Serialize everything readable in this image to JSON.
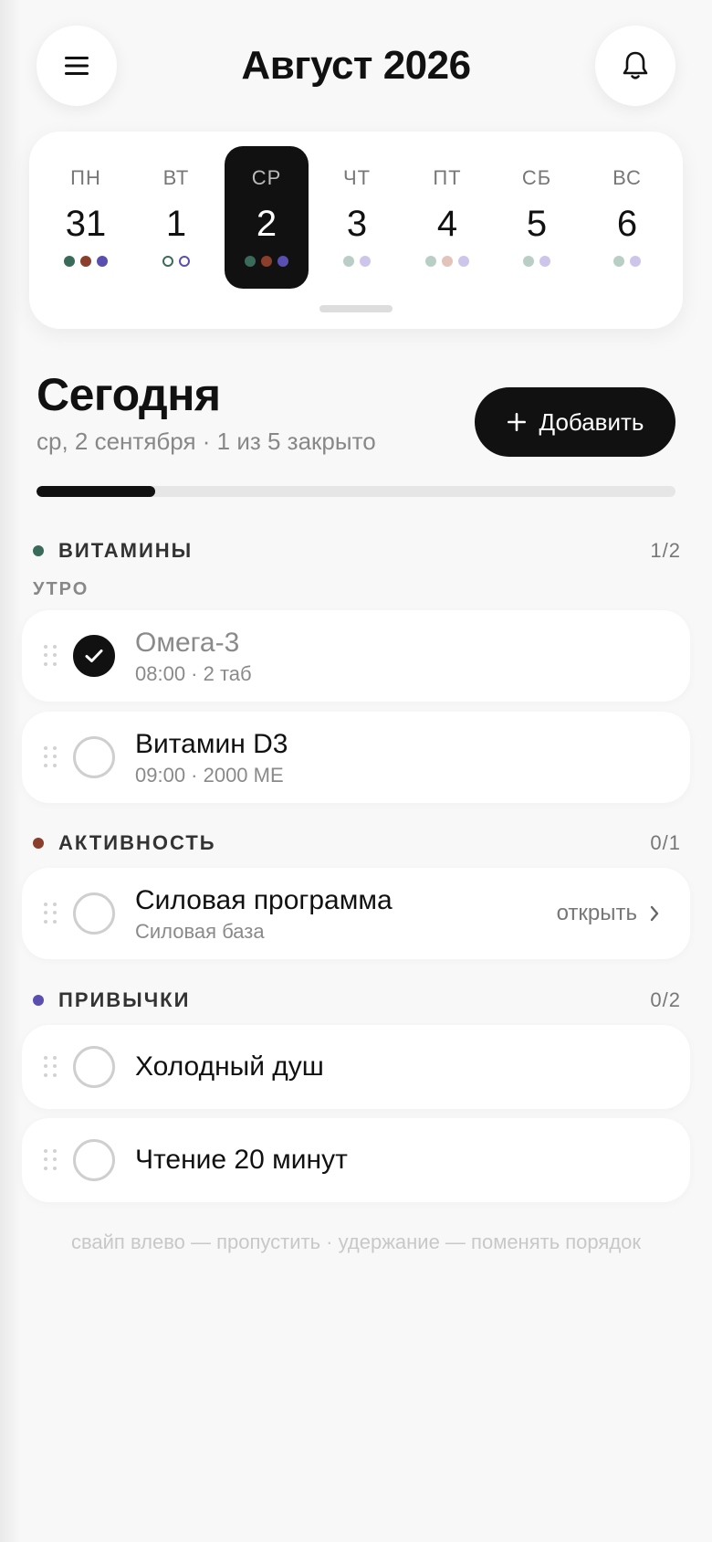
{
  "header": {
    "title": "Август 2026",
    "menu_icon": "menu-icon",
    "bell_icon": "bell-icon"
  },
  "week": {
    "days": [
      {
        "dow": "ПН",
        "num": "31",
        "active": false,
        "dots": [
          {
            "color": "#3a6b5a",
            "ring": false
          },
          {
            "color": "#8a3e2b",
            "ring": false
          },
          {
            "color": "#5a4fb0",
            "ring": false
          }
        ]
      },
      {
        "dow": "ВТ",
        "num": "1",
        "active": false,
        "dots": [
          {
            "color": "#3a6b5a",
            "ring": true
          },
          {
            "color": "#5a4fb0",
            "ring": true
          }
        ]
      },
      {
        "dow": "СР",
        "num": "2",
        "active": true,
        "dots": [
          {
            "color": "#3a6b5a",
            "ring": false
          },
          {
            "color": "#8a3e2b",
            "ring": false
          },
          {
            "color": "#5a4fb0",
            "ring": false
          }
        ]
      },
      {
        "dow": "ЧТ",
        "num": "3",
        "active": false,
        "dots": [
          {
            "color": "#b9cfc6",
            "ring": false
          },
          {
            "color": "#cdc6ea",
            "ring": false
          }
        ]
      },
      {
        "dow": "ПТ",
        "num": "4",
        "active": false,
        "dots": [
          {
            "color": "#b9cfc6",
            "ring": false
          },
          {
            "color": "#e2c4bb",
            "ring": false
          },
          {
            "color": "#cdc6ea",
            "ring": false
          }
        ]
      },
      {
        "dow": "СБ",
        "num": "5",
        "active": false,
        "dots": [
          {
            "color": "#b9cfc6",
            "ring": false
          },
          {
            "color": "#cdc6ea",
            "ring": false
          }
        ]
      },
      {
        "dow": "ВС",
        "num": "6",
        "active": false,
        "dots": [
          {
            "color": "#b9cfc6",
            "ring": false
          },
          {
            "color": "#cdc6ea",
            "ring": false
          }
        ]
      }
    ]
  },
  "today": {
    "title": "Сегодня",
    "subtitle": "ср, 2 сентября · 1 из 5 закрыто",
    "add_label": "Добавить",
    "add_icon": "plus-icon",
    "progress_fraction": 0.2
  },
  "groups": {
    "vitamins": {
      "name": "ВИТАМИНЫ",
      "count": "1/2",
      "color": "#3a6b5a",
      "subgroup": "УТРО"
    },
    "activity": {
      "name": "АКТИВНОСТЬ",
      "count": "0/1",
      "color": "#8a3e2b"
    },
    "habits": {
      "name": "ПРИВЫЧКИ",
      "count": "0/2",
      "color": "#5a4fb0"
    }
  },
  "items": {
    "omega": {
      "title": "Омега-3",
      "meta": "08:00 · 2 таб",
      "done": true
    },
    "vitd": {
      "title": "Витамин D3",
      "meta": "09:00 · 2000 МЕ",
      "done": false
    },
    "strength": {
      "title": "Силовая программа",
      "meta": "Силовая база",
      "open_label": "открыть",
      "done": false
    },
    "shower": {
      "title": "Холодный душ",
      "done": false
    },
    "reading": {
      "title": "Чтение 20 минут",
      "done": false
    }
  },
  "hint": "свайп влево — пропустить · удержание — поменять порядок"
}
